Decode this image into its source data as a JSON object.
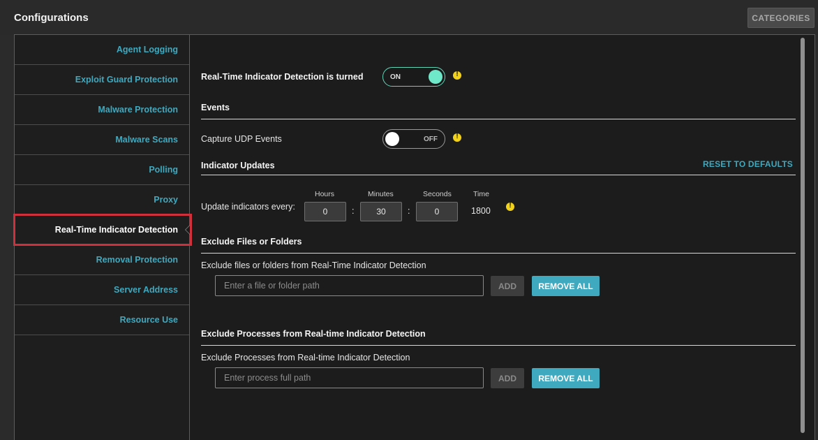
{
  "app": {
    "title": "Configurations",
    "categories_label": "CATEGORIES"
  },
  "sidebar": {
    "items": [
      {
        "label": "Agent Logging"
      },
      {
        "label": "Exploit Guard Protection"
      },
      {
        "label": "Malware Protection"
      },
      {
        "label": "Malware Scans"
      },
      {
        "label": "Polling"
      },
      {
        "label": "Proxy"
      },
      {
        "label": "Real-Time Indicator Detection",
        "active": true
      },
      {
        "label": "Removal Protection"
      },
      {
        "label": "Server Address"
      },
      {
        "label": "Resource Use"
      }
    ]
  },
  "main": {
    "rtid": {
      "label": "Real-Time Indicator Detection is turned",
      "toggle_state": "ON"
    },
    "events": {
      "heading": "Events",
      "capture_udp_label": "Capture UDP Events",
      "capture_udp_state": "OFF"
    },
    "indicator_updates": {
      "heading": "Indicator Updates",
      "reset_label": "RESET TO DEFAULTS",
      "update_label": "Update indicators every:",
      "hours_label": "Hours",
      "minutes_label": "Minutes",
      "seconds_label": "Seconds",
      "time_label": "Time",
      "hours_value": "0",
      "minutes_value": "30",
      "seconds_value": "0",
      "time_value": "1800",
      "separator": ":"
    },
    "exclude_files": {
      "heading": "Exclude Files or Folders",
      "description": "Exclude files or folders from Real-Time Indicator Detection",
      "placeholder": "Enter a file or folder path",
      "add_label": "ADD",
      "remove_all_label": "REMOVE ALL"
    },
    "exclude_processes": {
      "heading": "Exclude Processes from Real-time Indicator Detection",
      "description": "Exclude Processes from Real-time Indicator Detection",
      "placeholder": "Enter process full path",
      "add_label": "ADD",
      "remove_all_label": "REMOVE ALL"
    }
  },
  "colors": {
    "accent": "#3fa9bf",
    "toggle_on": "#6fe8c9",
    "warning": "#f2d21b",
    "highlight": "#d0303c"
  },
  "icons": {
    "warning": "warning-icon",
    "caret": "caret-left-icon"
  }
}
